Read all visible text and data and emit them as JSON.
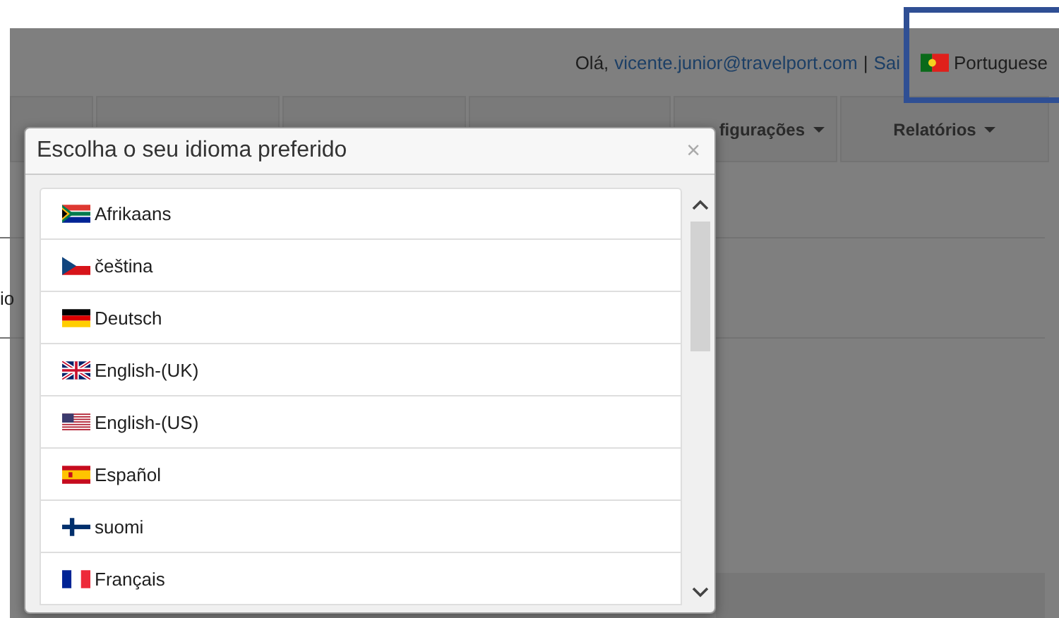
{
  "header": {
    "greeting": "Olá,",
    "email": "vicente.junior@travelport.com",
    "separator": "|",
    "logout": "Sai",
    "language": {
      "label": "Portuguese",
      "kind": "pt"
    }
  },
  "nav_tabs": [
    {
      "label": "figurações",
      "dropdown": true
    },
    {
      "label": "Relatórios",
      "dropdown": true
    }
  ],
  "page_fragment": "io",
  "modal": {
    "title": "Escolha o seu idioma preferido",
    "close": "×",
    "languages": [
      {
        "label": "Afrikaans",
        "kind": "za"
      },
      {
        "label": "čeština",
        "kind": "cz"
      },
      {
        "label": "Deutsch",
        "kind": "de"
      },
      {
        "label": "English-(UK)",
        "kind": "gb"
      },
      {
        "label": "English-(US)",
        "kind": "us"
      },
      {
        "label": "Español",
        "kind": "es"
      },
      {
        "label": "suomi",
        "kind": "fi"
      },
      {
        "label": "Français",
        "kind": "fr"
      }
    ]
  }
}
